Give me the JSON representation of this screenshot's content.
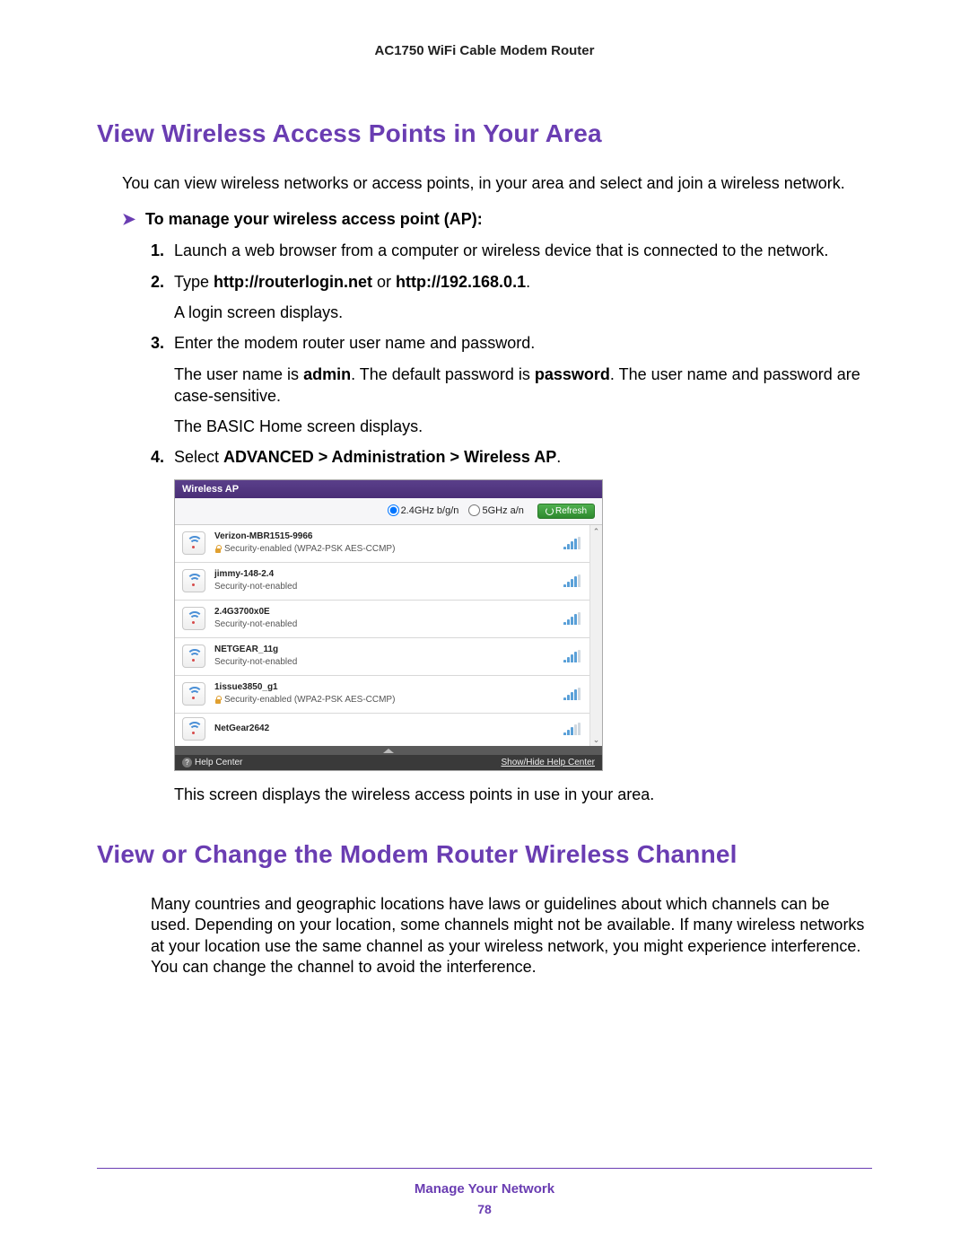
{
  "header": {
    "title": "AC1750 WiFi Cable Modem Router"
  },
  "section1": {
    "title": "View Wireless Access Points in Your Area",
    "intro": "You can view wireless networks or access points, in your area and select and join a wireless network.",
    "proc_heading": "To manage your wireless access point (AP):",
    "steps": {
      "s1_num": "1.",
      "s1": "Launch a web browser from a computer or wireless device that is connected to the network.",
      "s2_num": "2.",
      "s2_pre": "Type ",
      "s2_bold1": "http://routerlogin.net",
      "s2_mid": " or ",
      "s2_bold2": "http://192.168.0.1",
      "s2_post": ".",
      "s2_sub": "A login screen displays.",
      "s3_num": "3.",
      "s3": "Enter the modem router user name and password.",
      "s3_sub_a": "The user name is ",
      "s3_sub_b": "admin",
      "s3_sub_c": ". The default password is ",
      "s3_sub_d": "password",
      "s3_sub_e": ". The user name and password are case-sensitive.",
      "s3_sub2": "The BASIC Home screen displays.",
      "s4_num": "4.",
      "s4_pre": "Select ",
      "s4_bold": "ADVANCED > Administration > Wireless AP",
      "s4_post": "."
    },
    "after_shot": "This screen displays the wireless access points in use in your area."
  },
  "ui": {
    "title": "Wireless AP",
    "band24_label": "2.4GHz b/g/n",
    "band5_label": "5GHz a/n",
    "refresh_label": "Refresh",
    "help_center": "Help Center",
    "showhide": "Show/Hide Help Center",
    "networks": [
      {
        "name": "Verizon-MBR1515-9966",
        "security": "Security-enabled (WPA2-PSK AES-CCMP)",
        "locked": true,
        "bars": 4
      },
      {
        "name": "jimmy-148-2.4",
        "security": "Security-not-enabled",
        "locked": false,
        "bars": 4
      },
      {
        "name": "2.4G3700x0E",
        "security": "Security-not-enabled",
        "locked": false,
        "bars": 4
      },
      {
        "name": "NETGEAR_11g",
        "security": "Security-not-enabled",
        "locked": false,
        "bars": 4
      },
      {
        "name": "1issue3850_g1",
        "security": "Security-enabled (WPA2-PSK AES-CCMP)",
        "locked": true,
        "bars": 4
      },
      {
        "name": "NetGear2642",
        "security": "",
        "locked": false,
        "bars": 3
      }
    ]
  },
  "section2": {
    "title": "View or Change the Modem Router Wireless Channel",
    "body": "Many countries and geographic locations have laws or guidelines about which channels can be used. Depending on your location, some channels might not be available. If many wireless networks at your location use the same channel as your wireless network, you might experience interference. You can change the channel to avoid the interference."
  },
  "footer": {
    "label": "Manage Your Network",
    "page": "78"
  }
}
